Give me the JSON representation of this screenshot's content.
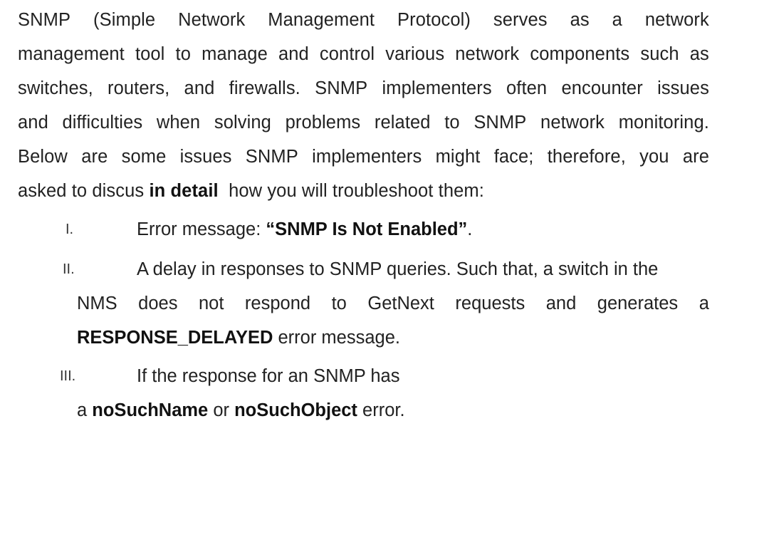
{
  "intro": {
    "lines": [
      [
        "SNMP",
        "(Simple",
        "Network",
        "Management",
        "Protocol)",
        "serves",
        "as",
        "a",
        "network"
      ],
      [
        "management",
        "tool",
        "to",
        "manage",
        "and",
        "control",
        "various",
        "network",
        "components",
        "such",
        "as"
      ],
      [
        "switches,",
        "routers,",
        "and",
        "firewalls.",
        "SNMP",
        "implementers",
        "often",
        "encounter",
        "issues"
      ],
      [
        "and",
        "difficulties",
        "when",
        "solving",
        "problems",
        "related",
        "to",
        "SNMP",
        "network",
        "monitoring."
      ],
      [
        "Below",
        "are",
        "some",
        "issues",
        "SNMP",
        "implementers",
        "might",
        "face;",
        "therefore,",
        "you",
        "are"
      ]
    ],
    "last_line": {
      "before": "asked to discus ",
      "bold": "in detail",
      "after": "  how you will troubleshoot them:"
    }
  },
  "items": [
    {
      "numeral": "I.",
      "lead": "Error message: ",
      "bold": "“SNMP Is Not Enabled”",
      "tail": "."
    },
    {
      "numeral": "II.",
      "line1": "A delay in responses to SNMP queries. Such that, a switch in the",
      "line2_words": [
        "NMS",
        "does",
        "not",
        "respond",
        "to",
        "GetNext",
        "requests",
        "and",
        "generates",
        "a"
      ],
      "line3_bold": "RESPONSE_DELAYED",
      "line3_rest": " error message."
    },
    {
      "numeral": "III.",
      "line1": "If the response for an SNMP has",
      "line2_pre": "a ",
      "line2_bold1": "noSuchName",
      "line2_mid": " or ",
      "line2_bold2": "noSuchObject",
      "line2_post": " error."
    }
  ]
}
